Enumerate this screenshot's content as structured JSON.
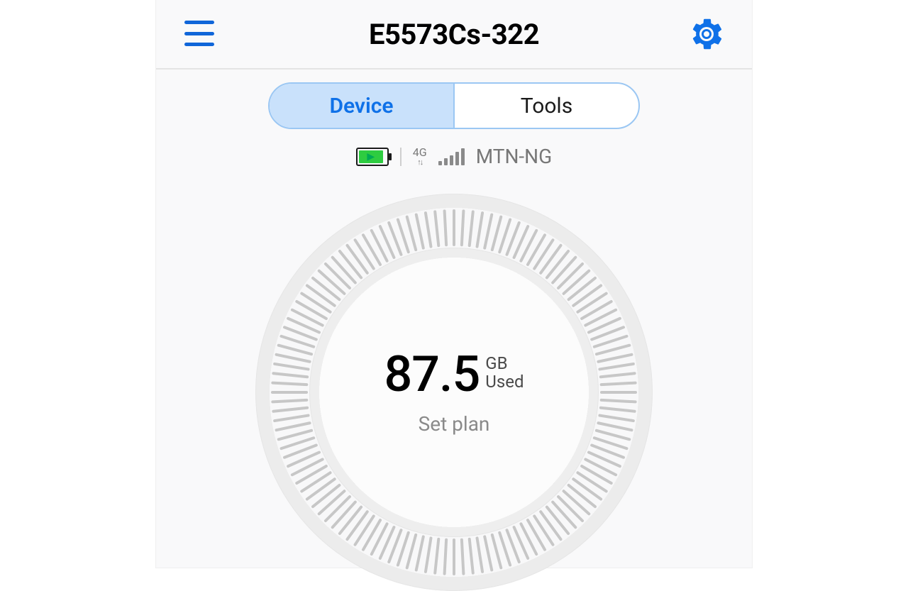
{
  "header": {
    "title": "E5573Cs-322"
  },
  "tabs": {
    "device": "Device",
    "tools": "Tools",
    "active": "device"
  },
  "status": {
    "network_type": "4G",
    "carrier": "MTN-NG",
    "signal_bars": 5
  },
  "usage": {
    "value": "87.5",
    "unit": "GB",
    "label": "Used",
    "set_plan": "Set plan"
  },
  "colors": {
    "accent": "#0f71e8",
    "battery_fill": "#2ecc40"
  }
}
